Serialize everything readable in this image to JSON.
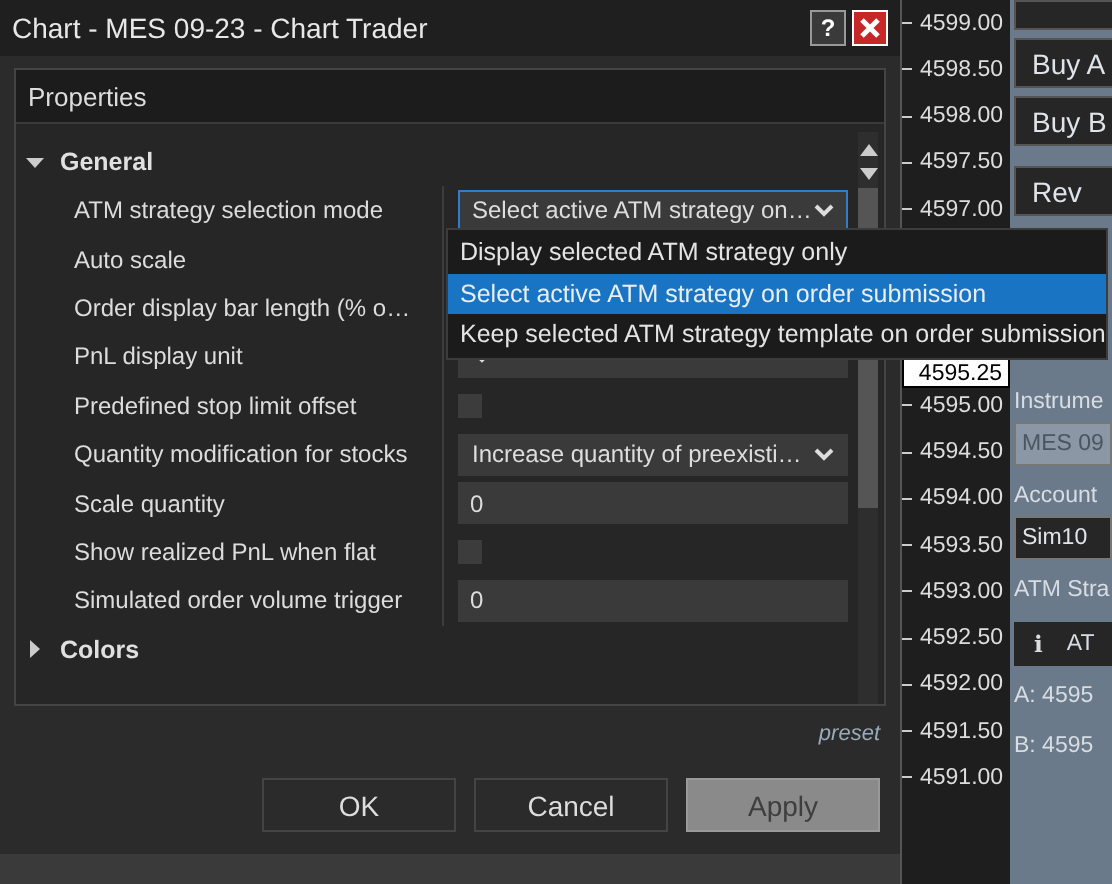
{
  "window": {
    "title": "Chart - MES 09-23 - Chart Trader",
    "help_button": "?"
  },
  "properties": {
    "header": "Properties",
    "groups": [
      {
        "name": "General",
        "expanded": true,
        "rows": [
          {
            "label": "ATM strategy selection mode",
            "kind": "select",
            "value": "Select active ATM strategy on…",
            "focused": true
          },
          {
            "label": "Auto scale",
            "kind": "covered"
          },
          {
            "label": "Order display bar length (% o…",
            "kind": "covered"
          },
          {
            "label": "PnL display unit",
            "kind": "select",
            "focused": false
          },
          {
            "label": "Predefined stop limit offset",
            "kind": "checkbox",
            "checked": false
          },
          {
            "label": "Quantity modification for stocks",
            "kind": "select",
            "value": "Increase quantity of preexisti…",
            "focused": false
          },
          {
            "label": "Scale quantity",
            "kind": "text",
            "value": "0"
          },
          {
            "label": "Show realized PnL when flat",
            "kind": "checkbox",
            "checked": false
          },
          {
            "label": "Simulated order volume trigger",
            "kind": "text",
            "value": "0"
          }
        ]
      },
      {
        "name": "Colors",
        "expanded": false
      }
    ]
  },
  "dropdown": {
    "options": [
      {
        "label": "Display selected ATM strategy only",
        "selected": false
      },
      {
        "label": "Select active ATM strategy on order submission",
        "selected": true
      },
      {
        "label": "Keep selected ATM strategy template on order submission",
        "selected": false
      }
    ]
  },
  "preset_link": "preset",
  "buttons": [
    {
      "label": "OK",
      "disabled": false
    },
    {
      "label": "Cancel",
      "disabled": false
    },
    {
      "label": "Apply",
      "disabled": true
    }
  ],
  "price_axis": {
    "upper_ticks": [
      "4599.00",
      "4598.50",
      "4598.00",
      "4597.50",
      "4597.00"
    ],
    "lower_ticks": [
      "4595.00",
      "4594.50",
      "4594.00",
      "4593.50",
      "4593.00",
      "4592.50",
      "4592.00",
      "4591.50",
      "4591.00"
    ],
    "last_price": "4595.25"
  },
  "chart_trader": {
    "buttons": [
      "Buy A",
      "Buy B",
      "Rev"
    ],
    "instrument_label": "Instrume",
    "instrument_value": "MES 09",
    "account_label": "Account",
    "account_value": "Sim10",
    "atm_label": "ATM Stra",
    "atm_info": "i",
    "atm_value": "AT",
    "ask": "A:  4595",
    "bid": "B:  4595"
  }
}
